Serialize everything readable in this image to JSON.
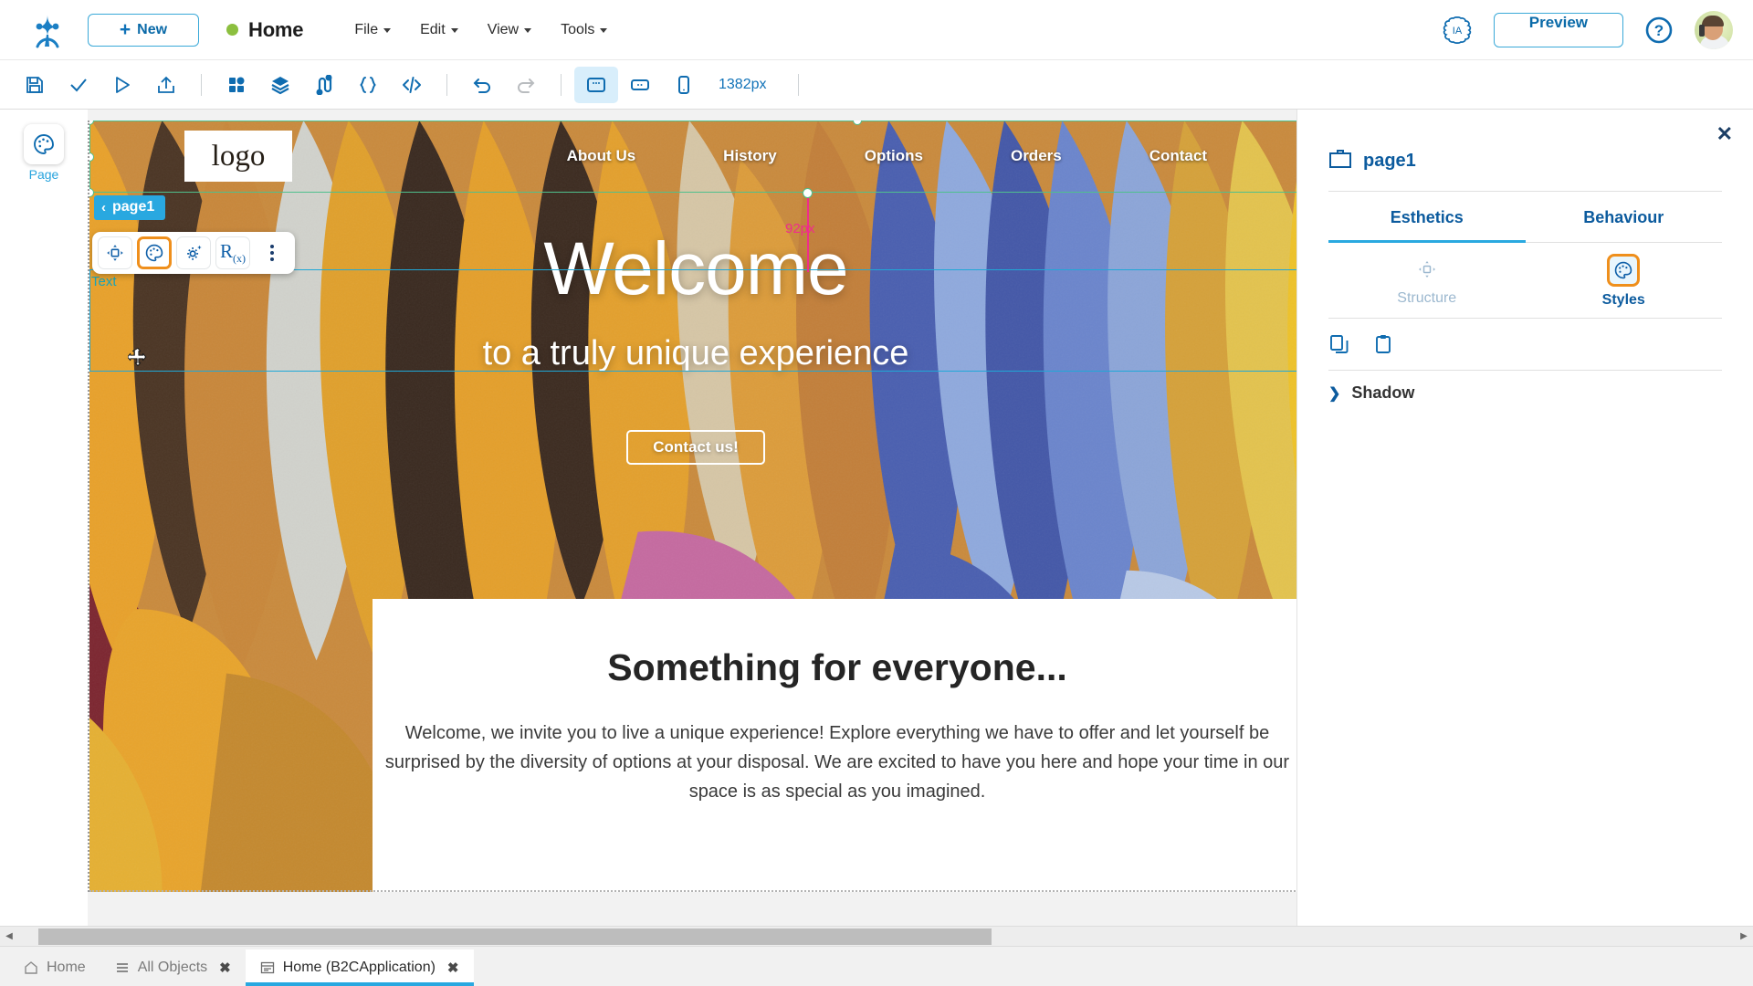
{
  "topbar": {
    "new_label": "New",
    "page_title": "Home",
    "status_color": "#8cbf3f",
    "menus": [
      {
        "label": "File"
      },
      {
        "label": "Edit"
      },
      {
        "label": "View"
      },
      {
        "label": "Tools"
      }
    ],
    "ia_label": "IA",
    "preview_label": "Preview",
    "help_label": "?"
  },
  "toolbar": {
    "items": [
      {
        "name": "save-icon",
        "state": "enabled"
      },
      {
        "name": "validate-check-icon",
        "state": "enabled"
      },
      {
        "name": "run-play-icon",
        "state": "enabled"
      },
      {
        "name": "publish-export-icon",
        "state": "enabled"
      },
      {
        "name": "widgets-grid-icon",
        "state": "enabled"
      },
      {
        "name": "layers-icon",
        "state": "enabled"
      },
      {
        "name": "flow-icon",
        "state": "enabled"
      },
      {
        "name": "braces-icon",
        "state": "enabled"
      },
      {
        "name": "code-icon",
        "state": "enabled"
      },
      {
        "name": "undo-icon",
        "state": "enabled"
      },
      {
        "name": "redo-icon",
        "state": "disabled"
      },
      {
        "name": "desktop-icon",
        "state": "active"
      },
      {
        "name": "tablet-icon",
        "state": "enabled"
      },
      {
        "name": "mobile-icon",
        "state": "enabled"
      }
    ],
    "viewport_size": "1382px"
  },
  "left_rail": {
    "items": [
      {
        "label": "Page",
        "icon": "palette-icon"
      }
    ]
  },
  "canvas": {
    "breadcrumb_label": "page1",
    "text_tag": "Text",
    "dimension_label": "92px",
    "float_toolbar": [
      {
        "name": "structure-icon",
        "selected": false
      },
      {
        "name": "palette-icon",
        "selected": true
      },
      {
        "name": "settings-sparkle-icon",
        "selected": false
      },
      {
        "name": "formula-rx-icon",
        "selected": false
      },
      {
        "name": "more-vertical-icon",
        "selected": false
      }
    ],
    "site": {
      "logo_text": "logo",
      "nav": [
        {
          "label": "About Us"
        },
        {
          "label": "History"
        },
        {
          "label": "Options"
        },
        {
          "label": "Orders"
        },
        {
          "label": "Contact"
        }
      ],
      "hero_title": "Welcome",
      "hero_subtitle": "to a truly unique experience",
      "hero_button": "Contact us!",
      "section_title": "Something for everyone...",
      "section_body": "Welcome, we invite you to live a unique experience! Explore everything we have to offer and let yourself be surprised by the diversity of options at your disposal. We are excited to have you here and hope your time in our space is as special as you imagined."
    }
  },
  "right_panel": {
    "close_label": "✕",
    "object_name": "page1",
    "tabs": [
      {
        "label": "Esthetics",
        "active": true
      },
      {
        "label": "Behaviour",
        "active": false
      }
    ],
    "subtabs": [
      {
        "label": "Structure",
        "icon": "structure-icon",
        "selected": false
      },
      {
        "label": "Styles",
        "icon": "palette-icon",
        "selected": true
      }
    ],
    "actions": [
      {
        "name": "copy-style-icon"
      },
      {
        "name": "paste-style-icon"
      }
    ],
    "sections": [
      {
        "label": "Shadow",
        "expanded": false
      }
    ]
  },
  "bottom_tabs": [
    {
      "label": "Home",
      "icon": "home-icon",
      "active": false,
      "closable": false
    },
    {
      "label": "All Objects",
      "icon": "list-icon",
      "active": false,
      "closable": true
    },
    {
      "label": "Home (B2CApplication)",
      "icon": "page-icon",
      "active": true,
      "closable": true
    }
  ]
}
